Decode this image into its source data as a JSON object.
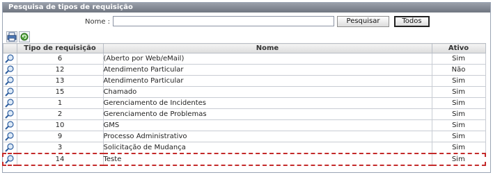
{
  "panel": {
    "title": "Pesquisa de tipos de requisição"
  },
  "search": {
    "label": "Nome :",
    "value": "",
    "placeholder": "",
    "search_button": "Pesquisar",
    "all_button": "Todos"
  },
  "toolbar": {
    "icons": [
      "print-icon",
      "refresh-icon"
    ]
  },
  "table": {
    "columns": [
      "",
      "Tipo de requisição",
      "Nome",
      "Ativo"
    ],
    "rows": [
      {
        "code": "6",
        "name": "(Aberto por Web/eMail)",
        "active": "Sim"
      },
      {
        "code": "12",
        "name": "Atendimento Particular",
        "active": "Não"
      },
      {
        "code": "13",
        "name": "Atendimento Particular",
        "active": "Sim"
      },
      {
        "code": "15",
        "name": "Chamado",
        "active": "Sim"
      },
      {
        "code": "1",
        "name": "Gerenciamento de Incidentes",
        "active": "Sim"
      },
      {
        "code": "2",
        "name": "Gerenciamento de Problemas",
        "active": "Sim"
      },
      {
        "code": "10",
        "name": "GMS",
        "active": "Sim"
      },
      {
        "code": "9",
        "name": "Processo Administrativo",
        "active": "Sim"
      },
      {
        "code": "3",
        "name": "Solicitação de Mudança",
        "active": "Sim"
      },
      {
        "code": "14",
        "name": "Teste",
        "active": "Sim"
      }
    ],
    "highlighted_row": 9
  },
  "colors": {
    "title_bar": "#7d838e",
    "highlight": "#c42a2a",
    "border": "#9aa4b4"
  }
}
